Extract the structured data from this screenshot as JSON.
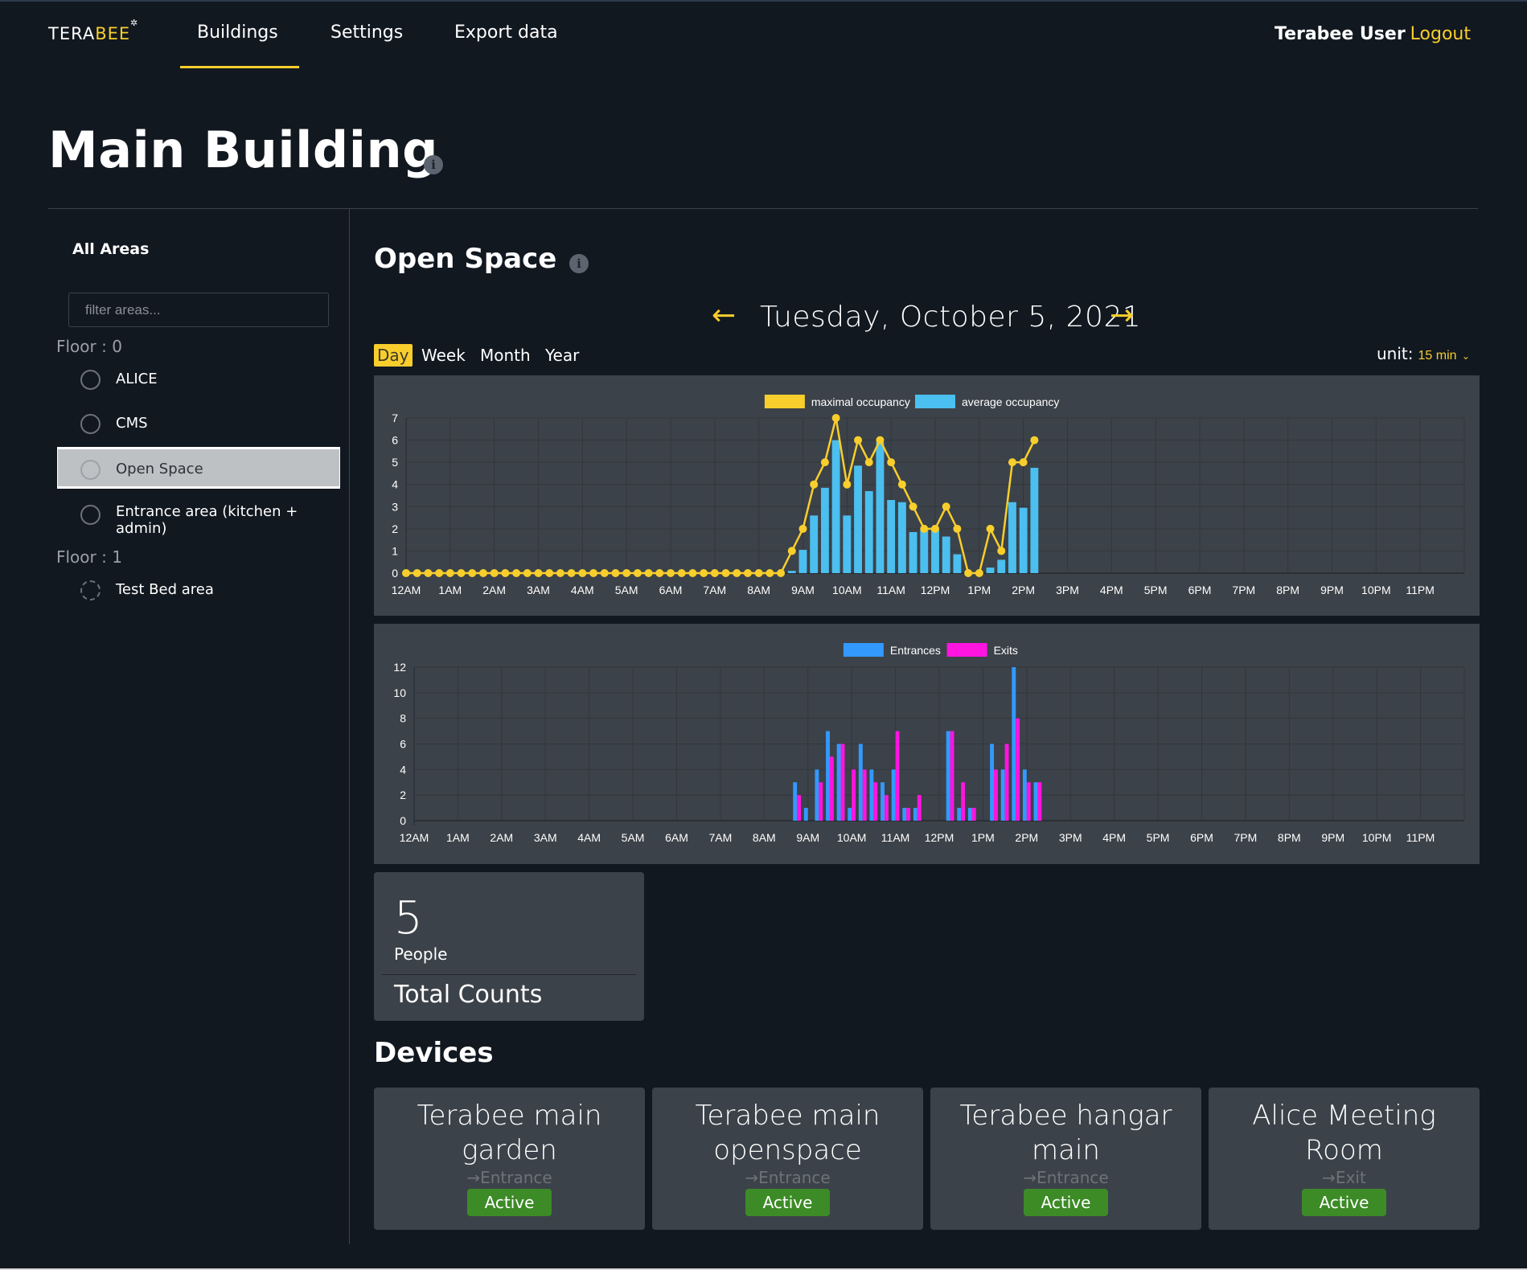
{
  "nav": {
    "logo_white": "TERA",
    "logo_yellow": "BEE",
    "items": [
      {
        "label": "Buildings",
        "active": true
      },
      {
        "label": "Settings",
        "active": false
      },
      {
        "label": "Export data",
        "active": false
      }
    ],
    "user_name": "Terabee User",
    "logout_label": "Logout"
  },
  "page": {
    "title": "Main Building"
  },
  "sidebar": {
    "title": "All Areas",
    "filter_placeholder": "filter areas...",
    "floors": [
      {
        "label": "Floor : 0",
        "areas": [
          {
            "label": "ALICE",
            "selected": false
          },
          {
            "label": "CMS",
            "selected": false
          },
          {
            "label": "Open Space",
            "selected": true
          },
          {
            "label": "Entrance area (kitchen + admin)",
            "selected": false
          }
        ]
      },
      {
        "label": "Floor : 1",
        "areas": [
          {
            "label": "Test Bed area",
            "selected": false,
            "dashed": true
          }
        ]
      }
    ]
  },
  "main": {
    "section_title": "Open Space",
    "date": "Tuesday, October 5, 2021",
    "prev_arrow": "←",
    "next_arrow": "→",
    "periods": [
      {
        "label": "Day",
        "active": true
      },
      {
        "label": "Week",
        "active": false
      },
      {
        "label": "Month",
        "active": false
      },
      {
        "label": "Year",
        "active": false
      }
    ],
    "unit_label": "unit:",
    "unit_value": "15 min"
  },
  "colors": {
    "accent": "#f8ce2c",
    "avg_bar": "#4bbfef",
    "entrances": "#3399ff",
    "exits": "#ff14e0",
    "active_badge": "#3c8b26"
  },
  "chart_data": [
    {
      "type": "bar",
      "title": "",
      "xlabel": "",
      "ylabel": "",
      "interval_minutes": 15,
      "ylim": [
        0,
        7
      ],
      "yticks": [
        0,
        1,
        2,
        3,
        4,
        5,
        6,
        7
      ],
      "xtick_labels": [
        "12AM",
        "1AM",
        "2AM",
        "3AM",
        "4AM",
        "5AM",
        "6AM",
        "7AM",
        "8AM",
        "9AM",
        "10AM",
        "11AM",
        "12PM",
        "1PM",
        "2PM",
        "3PM",
        "4PM",
        "5PM",
        "6PM",
        "7PM",
        "8PM",
        "9PM",
        "10PM",
        "11PM"
      ],
      "grid": true,
      "legend_position": "top",
      "series": [
        {
          "name": "maximal occupancy",
          "kind": "line",
          "values": [
            0,
            0,
            0,
            0,
            0,
            0,
            0,
            0,
            0,
            0,
            0,
            0,
            0,
            0,
            0,
            0,
            0,
            0,
            0,
            0,
            0,
            0,
            0,
            0,
            0,
            0,
            0,
            0,
            0,
            0,
            0,
            0,
            0,
            0,
            0,
            1,
            2,
            4,
            5,
            7,
            4,
            6,
            5,
            6,
            5,
            4,
            3,
            2,
            2,
            3,
            2,
            0,
            0,
            2,
            1,
            5,
            5,
            6
          ]
        },
        {
          "name": "average occupancy",
          "kind": "bar",
          "values": [
            0,
            0,
            0,
            0,
            0,
            0,
            0,
            0,
            0,
            0,
            0,
            0,
            0,
            0,
            0,
            0,
            0,
            0,
            0,
            0,
            0,
            0,
            0,
            0,
            0,
            0,
            0,
            0,
            0,
            0,
            0,
            0,
            0,
            0,
            0,
            0.1,
            1.05,
            2.6,
            3.85,
            6.0,
            2.6,
            4.85,
            3.7,
            5.9,
            3.3,
            3.2,
            1.85,
            1.95,
            1.95,
            1.65,
            0.85,
            0,
            0,
            0.25,
            0.6,
            3.2,
            2.95,
            4.75
          ]
        }
      ]
    },
    {
      "type": "bar",
      "title": "",
      "xlabel": "",
      "ylabel": "",
      "interval_minutes": 15,
      "ylim": [
        0,
        12
      ],
      "yticks": [
        0,
        2,
        4,
        6,
        8,
        10,
        12
      ],
      "xtick_labels": [
        "12AM",
        "1AM",
        "2AM",
        "3AM",
        "4AM",
        "5AM",
        "6AM",
        "7AM",
        "8AM",
        "9AM",
        "10AM",
        "11AM",
        "12PM",
        "1PM",
        "2PM",
        "3PM",
        "4PM",
        "5PM",
        "6PM",
        "7PM",
        "8PM",
        "9PM",
        "10PM",
        "11PM"
      ],
      "grid": true,
      "legend_position": "top",
      "series": [
        {
          "name": "Entrances",
          "values": [
            0,
            0,
            0,
            0,
            0,
            0,
            0,
            0,
            0,
            0,
            0,
            0,
            0,
            0,
            0,
            0,
            0,
            0,
            0,
            0,
            0,
            0,
            0,
            0,
            0,
            0,
            0,
            0,
            0,
            0,
            0,
            0,
            0,
            0,
            0,
            3,
            1,
            4,
            7,
            6,
            1,
            6,
            4,
            3,
            4,
            1,
            1,
            0,
            0,
            7,
            1,
            1,
            0,
            6,
            4,
            12,
            4,
            3
          ]
        },
        {
          "name": "Exits",
          "values": [
            0,
            0,
            0,
            0,
            0,
            0,
            0,
            0,
            0,
            0,
            0,
            0,
            0,
            0,
            0,
            0,
            0,
            0,
            0,
            0,
            0,
            0,
            0,
            0,
            0,
            0,
            0,
            0,
            0,
            0,
            0,
            0,
            0,
            0,
            0,
            2,
            0,
            3,
            5,
            6,
            4,
            4,
            3,
            2,
            7,
            1,
            2,
            0,
            0,
            7,
            3,
            1,
            0,
            4,
            6,
            8,
            3,
            3
          ]
        }
      ]
    }
  ],
  "total_counts": {
    "value": "5",
    "unit": "People",
    "label": "Total Counts"
  },
  "devices": {
    "title": "Devices",
    "items": [
      {
        "name": "Terabee main garden",
        "type": "→Entrance",
        "status": "Active"
      },
      {
        "name": "Terabee main openspace",
        "type": "→Entrance",
        "status": "Active"
      },
      {
        "name": "Terabee hangar main",
        "type": "→Entrance",
        "status": "Active"
      },
      {
        "name": "Alice Meeting Room",
        "type": "→Exit",
        "status": "Active"
      }
    ]
  }
}
